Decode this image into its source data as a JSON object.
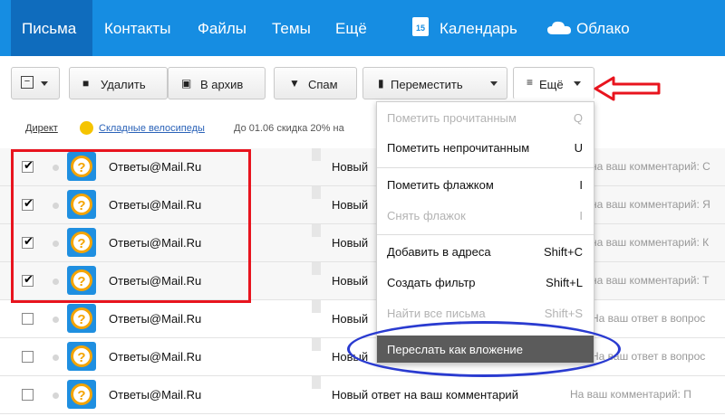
{
  "nav": {
    "items": [
      "Письма",
      "Контакты",
      "Файлы",
      "Темы",
      "Ещё"
    ],
    "calendar_label": "Календарь",
    "calendar_day": "15",
    "cloud_label": "Облако"
  },
  "toolbar": {
    "delete_label": "Удалить",
    "archive_label": "В архив",
    "spam_label": "Спам",
    "move_label": "Переместить",
    "more_label": "Ещё"
  },
  "ad": {
    "label": "Директ",
    "title": "Складные велосипеды",
    "text": "До 01.06 скидка 20% на"
  },
  "messages": [
    {
      "sender": "Ответы@Mail.Ru",
      "subject": "Новый",
      "snippet": "на ваш комментарий: С",
      "checked": true
    },
    {
      "sender": "Ответы@Mail.Ru",
      "subject": "Новый",
      "snippet": "на ваш комментарий: Я",
      "checked": true
    },
    {
      "sender": "Ответы@Mail.Ru",
      "subject": "Новый",
      "snippet": "на ваш комментарий: К",
      "checked": true
    },
    {
      "sender": "Ответы@Mail.Ru",
      "subject": "Новый",
      "snippet": "на ваш комментарий: Т",
      "checked": true
    },
    {
      "sender": "Ответы@Mail.Ru",
      "subject": "Новый",
      "snippet": "На ваш ответ в вопрос",
      "checked": false
    },
    {
      "sender": "Ответы@Mail.Ru",
      "subject": "Новый",
      "snippet": "На ваш ответ в вопрос",
      "checked": false
    },
    {
      "sender": "Ответы@Mail.Ru",
      "subject": "Новый ответ на ваш комментарий",
      "snippet": "На ваш комментарий: П",
      "checked": false
    }
  ],
  "menu": {
    "items": [
      {
        "label": "Пометить прочитанным",
        "shortcut": "Q",
        "enabled": false
      },
      {
        "label": "Пометить непрочитанным",
        "shortcut": "U",
        "enabled": true
      },
      {
        "label": "Пометить флажком",
        "shortcut": "I",
        "enabled": true
      },
      {
        "label": "Снять флажок",
        "shortcut": "I",
        "enabled": false
      },
      {
        "label": "Добавить в адреса",
        "shortcut": "Shift+C",
        "enabled": true
      },
      {
        "label": "Создать фильтр",
        "shortcut": "Shift+L",
        "enabled": true
      },
      {
        "label": "Найти все письма",
        "shortcut": "Shift+S",
        "enabled": false
      },
      {
        "label": "Переслать как вложение",
        "shortcut": "",
        "enabled": true,
        "highlighted": true
      }
    ]
  },
  "colors": {
    "nav_bg": "#168de2",
    "nav_active": "#0f6cbd",
    "annotation_red": "#e8141e",
    "annotation_blue": "#2a3bd0",
    "menu_highlight": "#5b5b5b",
    "avatar_orange": "#f4a400"
  },
  "icons": [
    "select-all-icon",
    "trash-icon",
    "archive-icon",
    "thumbs-down-icon",
    "folder-icon",
    "menu-lines-icon",
    "calendar-icon",
    "cloud-icon",
    "answers-avatar-icon",
    "flag-icon",
    "red-arrow-annotation"
  ]
}
